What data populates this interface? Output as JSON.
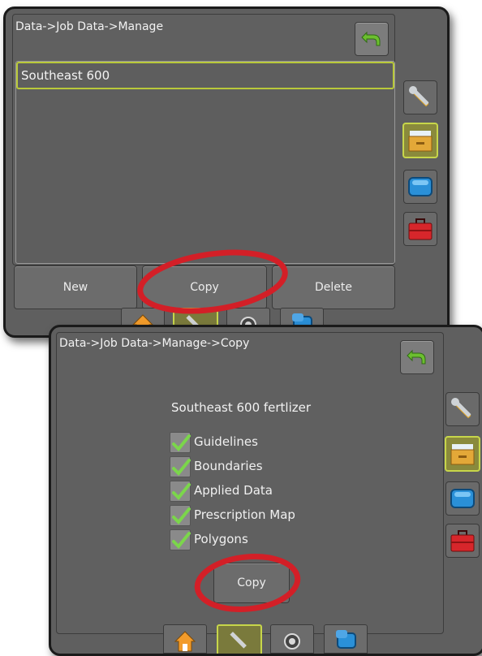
{
  "colors": {
    "screen_bg": "#5f5f5f",
    "selected_border": "#b9c93a",
    "annotation_circle": "#d31f27",
    "back_arrow": "#6cbf2f",
    "check_mark": "#7bd64b"
  },
  "screen1": {
    "breadcrumb": "Data->Job Data->Manage",
    "list": {
      "items": [
        {
          "label": "Southeast 600",
          "selected": true
        }
      ]
    },
    "buttons": {
      "new": "New",
      "copy": "Copy",
      "delete": "Delete"
    },
    "back_icon": "back-arrow-icon",
    "side_tabs": [
      {
        "icon": "tools-icon",
        "active": false
      },
      {
        "icon": "data-drawer-icon",
        "active": true
      },
      {
        "icon": "display-icon",
        "active": false
      },
      {
        "icon": "toolbox-icon",
        "active": false
      }
    ],
    "bottom_tabs": [
      {
        "icon": "home-icon",
        "active": false
      },
      {
        "icon": "tools-icon",
        "active": true
      },
      {
        "icon": "gnss-icon",
        "active": false
      },
      {
        "icon": "display-icon",
        "active": false
      }
    ]
  },
  "screen2": {
    "breadcrumb": "Data->Job Data->Manage->Copy",
    "job_name": "Southeast 600 fertlizer",
    "options": [
      {
        "label": "Guidelines",
        "checked": true
      },
      {
        "label": "Boundaries",
        "checked": true
      },
      {
        "label": "Applied Data",
        "checked": true
      },
      {
        "label": "Prescription Map",
        "checked": true
      },
      {
        "label": "Polygons",
        "checked": true
      }
    ],
    "copy_button": "Copy",
    "back_icon": "back-arrow-icon",
    "side_tabs": [
      {
        "icon": "tools-icon",
        "active": false
      },
      {
        "icon": "data-drawer-icon",
        "active": true
      },
      {
        "icon": "display-icon",
        "active": false
      },
      {
        "icon": "toolbox-icon",
        "active": false
      }
    ],
    "bottom_tabs": [
      {
        "icon": "home-icon",
        "active": false
      },
      {
        "icon": "tools-icon",
        "active": true
      },
      {
        "icon": "gnss-icon",
        "active": false
      },
      {
        "icon": "display-icon",
        "active": false
      }
    ]
  }
}
